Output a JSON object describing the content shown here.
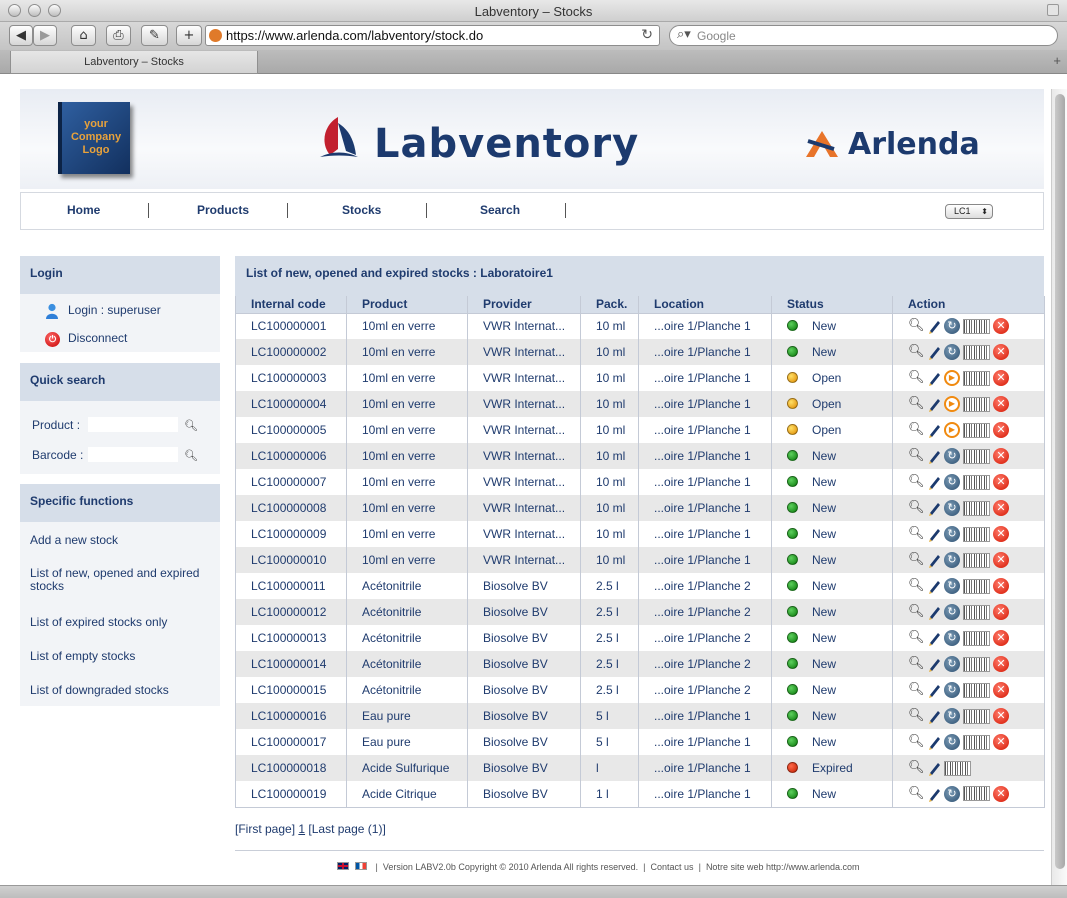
{
  "window": {
    "title": "Labventory – Stocks"
  },
  "browser": {
    "url": "https://www.arlenda.com/labventory/stock.do",
    "search_placeholder": "Google",
    "tab_label": "Labventory – Stocks"
  },
  "header": {
    "company_logo_lines": [
      "your",
      "Company",
      "Logo"
    ],
    "product_name": "Labventory",
    "brand_name": "Arlenda"
  },
  "nav": {
    "items": [
      "Home",
      "Products",
      "Stocks",
      "Search"
    ],
    "lab_select": "LC1"
  },
  "login": {
    "title": "Login",
    "user": "Login : superuser",
    "disconnect": "Disconnect"
  },
  "quick_search": {
    "title": "Quick search",
    "product_label": "Product :",
    "barcode_label": "Barcode :"
  },
  "specific_functions": {
    "title": "Specific functions",
    "links": [
      "Add a new stock",
      "List of new, opened and expired stocks",
      "List of expired stocks only",
      "List of empty stocks",
      "List of downgraded stocks"
    ]
  },
  "main": {
    "title": "List of new, opened and expired stocks : Laboratoire1",
    "columns": [
      "Internal code",
      "Product",
      "Provider",
      "Pack.",
      "Location",
      "Status",
      "Action"
    ],
    "rows": [
      {
        "code": "LC100000001",
        "product": "10ml en verre",
        "provider": "VWR Internat...",
        "pack": "10 ml",
        "location": "...oire 1/Planche 1",
        "status": "New",
        "status_color": "green"
      },
      {
        "code": "LC100000002",
        "product": "10ml en verre",
        "provider": "VWR Internat...",
        "pack": "10 ml",
        "location": "...oire 1/Planche 1",
        "status": "New",
        "status_color": "green"
      },
      {
        "code": "LC100000003",
        "product": "10ml en verre",
        "provider": "VWR Internat...",
        "pack": "10 ml",
        "location": "...oire 1/Planche 1",
        "status": "Open",
        "status_color": "orange"
      },
      {
        "code": "LC100000004",
        "product": "10ml en verre",
        "provider": "VWR Internat...",
        "pack": "10 ml",
        "location": "...oire 1/Planche 1",
        "status": "Open",
        "status_color": "orange"
      },
      {
        "code": "LC100000005",
        "product": "10ml en verre",
        "provider": "VWR Internat...",
        "pack": "10 ml",
        "location": "...oire 1/Planche 1",
        "status": "Open",
        "status_color": "orange"
      },
      {
        "code": "LC100000006",
        "product": "10ml en verre",
        "provider": "VWR Internat...",
        "pack": "10 ml",
        "location": "...oire 1/Planche 1",
        "status": "New",
        "status_color": "green"
      },
      {
        "code": "LC100000007",
        "product": "10ml en verre",
        "provider": "VWR Internat...",
        "pack": "10 ml",
        "location": "...oire 1/Planche 1",
        "status": "New",
        "status_color": "green"
      },
      {
        "code": "LC100000008",
        "product": "10ml en verre",
        "provider": "VWR Internat...",
        "pack": "10 ml",
        "location": "...oire 1/Planche 1",
        "status": "New",
        "status_color": "green"
      },
      {
        "code": "LC100000009",
        "product": "10ml en verre",
        "provider": "VWR Internat...",
        "pack": "10 ml",
        "location": "...oire 1/Planche 1",
        "status": "New",
        "status_color": "green"
      },
      {
        "code": "LC100000010",
        "product": "10ml en verre",
        "provider": "VWR Internat...",
        "pack": "10 ml",
        "location": "...oire 1/Planche 1",
        "status": "New",
        "status_color": "green"
      },
      {
        "code": "LC100000011",
        "product": "Acétonitrile",
        "provider": "Biosolve BV",
        "pack": "2.5 l",
        "location": "...oire 1/Planche 2",
        "status": "New",
        "status_color": "green"
      },
      {
        "code": "LC100000012",
        "product": "Acétonitrile",
        "provider": "Biosolve BV",
        "pack": "2.5 l",
        "location": "...oire 1/Planche 2",
        "status": "New",
        "status_color": "green"
      },
      {
        "code": "LC100000013",
        "product": "Acétonitrile",
        "provider": "Biosolve BV",
        "pack": "2.5 l",
        "location": "...oire 1/Planche 2",
        "status": "New",
        "status_color": "green"
      },
      {
        "code": "LC100000014",
        "product": "Acétonitrile",
        "provider": "Biosolve BV",
        "pack": "2.5 l",
        "location": "...oire 1/Planche 2",
        "status": "New",
        "status_color": "green"
      },
      {
        "code": "LC100000015",
        "product": "Acétonitrile",
        "provider": "Biosolve BV",
        "pack": "2.5 l",
        "location": "...oire 1/Planche 2",
        "status": "New",
        "status_color": "green"
      },
      {
        "code": "LC100000016",
        "product": "Eau pure",
        "provider": "Biosolve BV",
        "pack": "5 l",
        "location": "...oire 1/Planche 1",
        "status": "New",
        "status_color": "green"
      },
      {
        "code": "LC100000017",
        "product": "Eau pure",
        "provider": "Biosolve BV",
        "pack": "5 l",
        "location": "...oire 1/Planche 1",
        "status": "New",
        "status_color": "green"
      },
      {
        "code": "LC100000018",
        "product": "Acide Sulfurique",
        "provider": "Biosolve BV",
        "pack": "l",
        "location": "...oire 1/Planche 1",
        "status": "Expired",
        "status_color": "red"
      },
      {
        "code": "LC100000019",
        "product": "Acide Citrique",
        "provider": "Biosolve BV",
        "pack": "1 l",
        "location": "...oire 1/Planche 1",
        "status": "New",
        "status_color": "green"
      }
    ],
    "pager": {
      "first": "[First page]",
      "page": "1",
      "last": "[Last page (1)]"
    }
  },
  "footer": {
    "version": "Version LABV2.0b Copyright © 2010 Arlenda All rights reserved.",
    "contact": "Contact us",
    "site": "Notre site web http://www.arlenda.com",
    "separator": "|"
  },
  "colors": {
    "accent": "#1f3b6e",
    "header_bg": "#d6dee9",
    "status_new": "#11881a",
    "status_open": "#f0a010",
    "status_expired": "#d42a10"
  }
}
